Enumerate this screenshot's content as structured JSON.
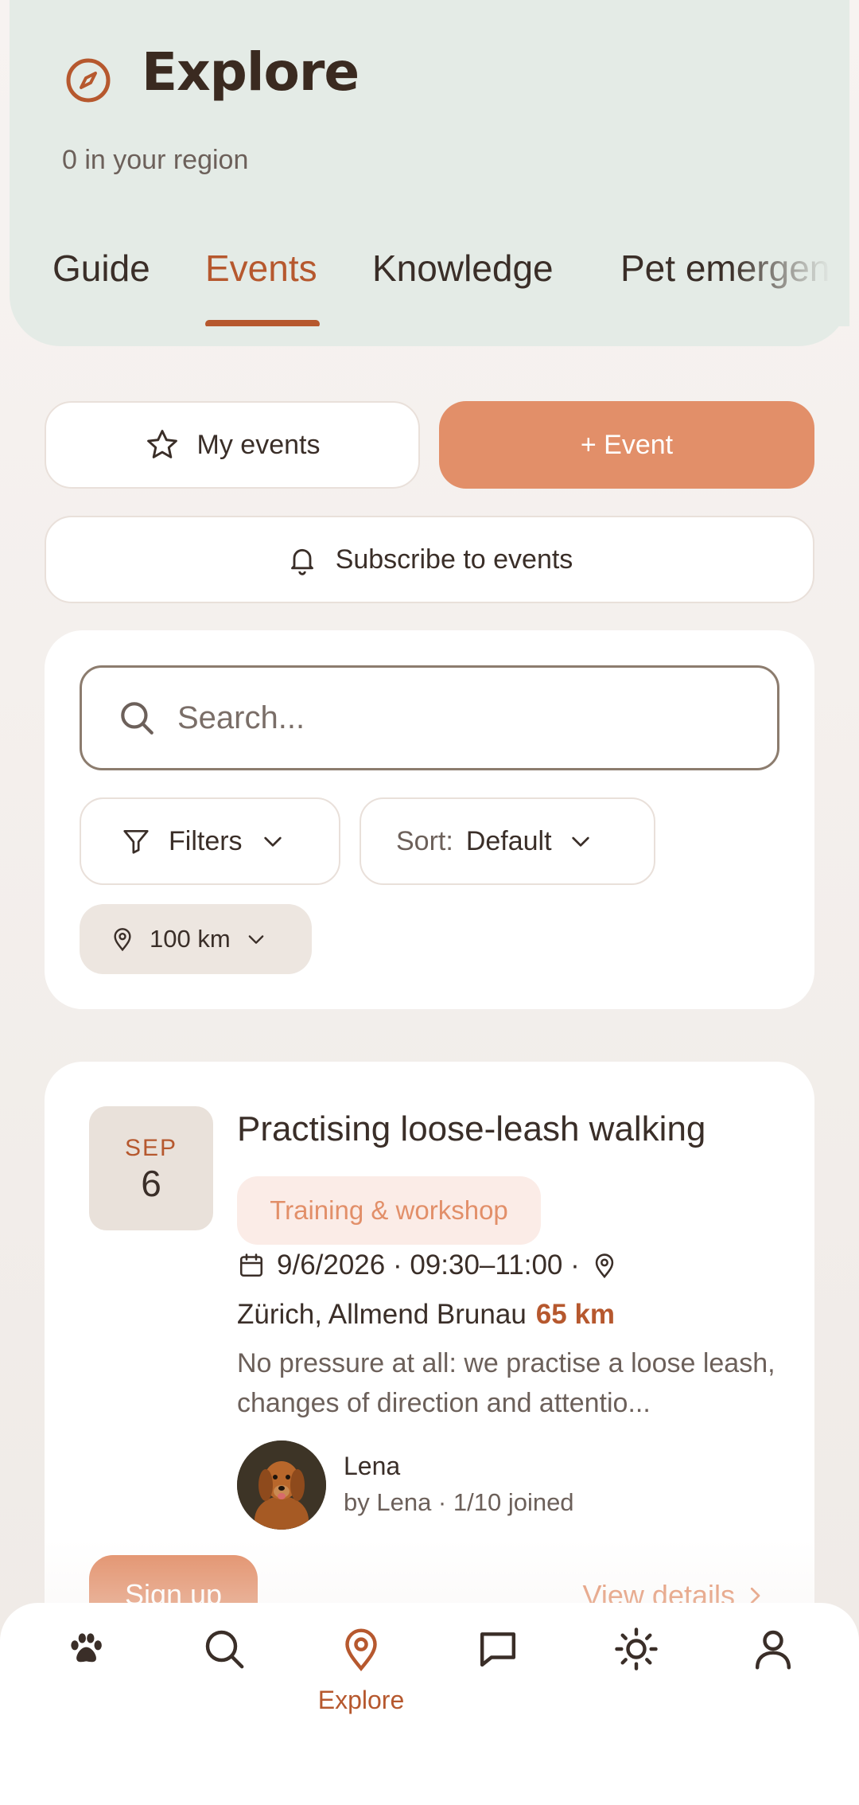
{
  "header": {
    "title": "Explore",
    "subtitle": "0 in your region",
    "tabs": [
      {
        "label": "Guide",
        "active": false
      },
      {
        "label": "Events",
        "active": true
      },
      {
        "label": "Knowledge",
        "active": false
      },
      {
        "label": "Pet emergency",
        "active": false
      }
    ]
  },
  "actions": {
    "my_events": "My events",
    "add_event": "+ Event",
    "subscribe": "Subscribe to events"
  },
  "filters": {
    "search_placeholder": "Search...",
    "filters_label": "Filters",
    "sort_prefix": "Sort:",
    "sort_value": "Default",
    "radius": "100 km"
  },
  "event": {
    "month": "SEP",
    "day": "6",
    "title": "Practising loose-leash walking",
    "category": "Training & workshop",
    "datetime": "9/6/2026 · 09:30–11:00 ·",
    "location": "Zürich, Allmend Brunau",
    "distance": "65 km",
    "description": "No pressure at all: we practise a loose leash, changes of direction and attentio...",
    "organizer_name": "Lena",
    "organizer_meta": "by Lena · 1/10 joined",
    "signup_label": "Sign up",
    "details_label": "View details"
  },
  "bottom_nav": {
    "items": [
      "paw-icon",
      "search-icon",
      "map-pin-icon",
      "chat-icon",
      "sun-icon",
      "user-icon"
    ],
    "active_label": "Explore"
  },
  "colors": {
    "accent": "#b6582e",
    "primary_button": "#e28f69",
    "header_bg": "#e4ebe6"
  }
}
